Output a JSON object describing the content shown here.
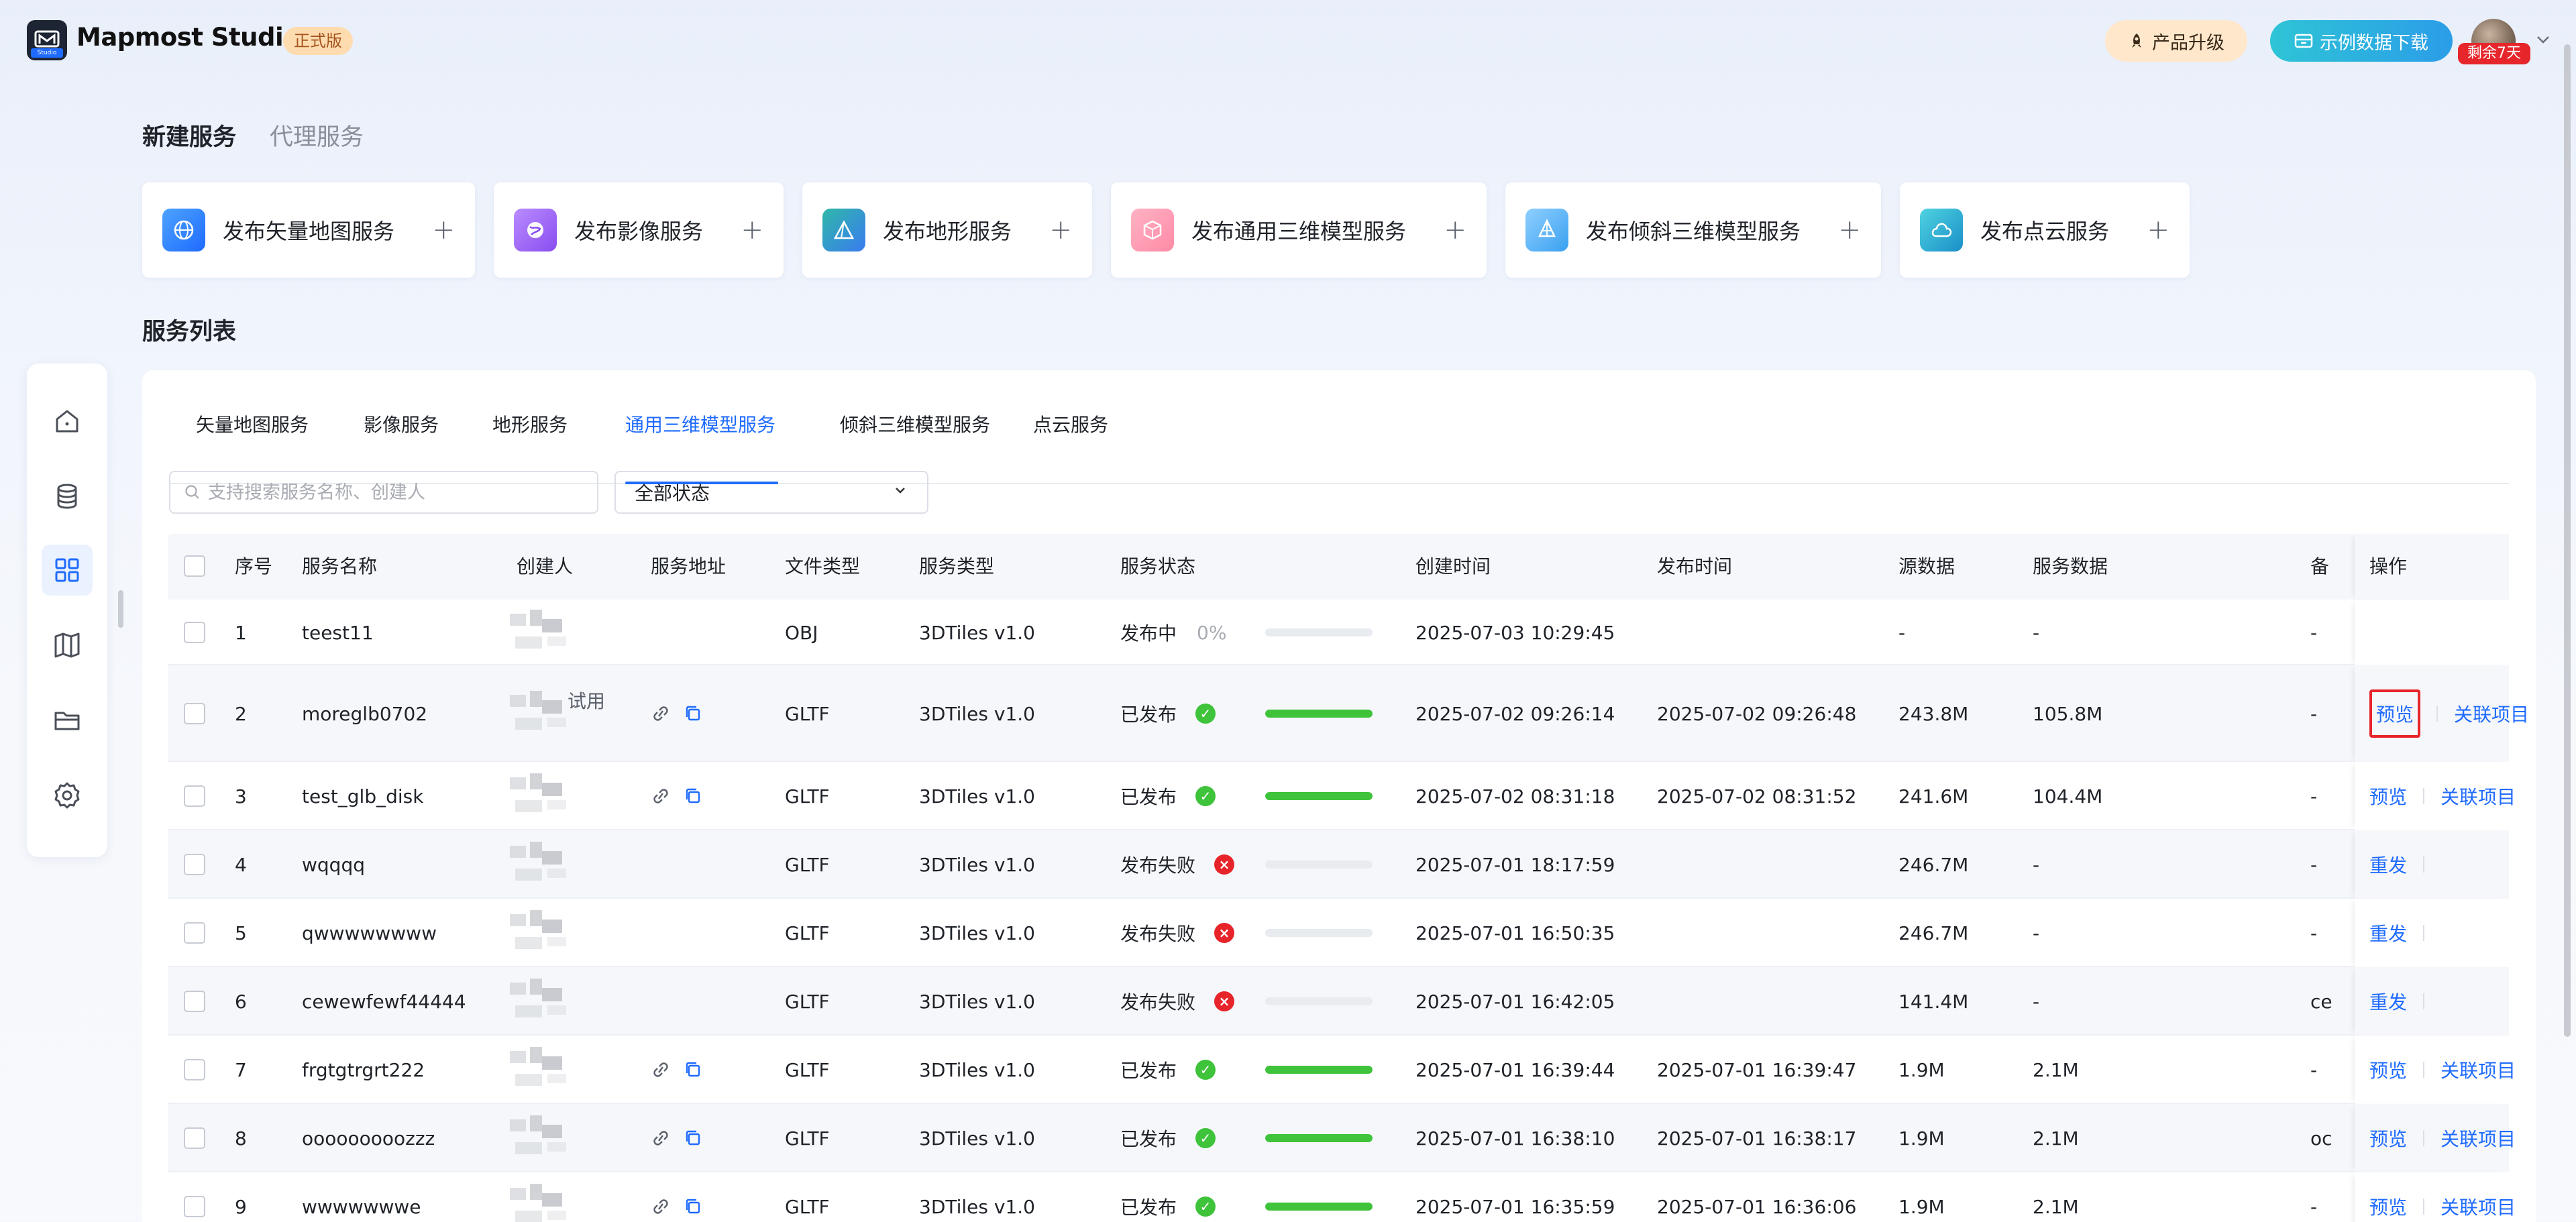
{
  "app": {
    "brand": "Mapmost Studio",
    "logo_sub": "Studio",
    "edition": "正式版",
    "upgrade_label": "产品升级",
    "download_label": "示例数据下载",
    "trial_badge": "剩余7天"
  },
  "top_tabs": [
    {
      "label": "新建服务",
      "active": true
    },
    {
      "label": "代理服务",
      "active": false
    }
  ],
  "publish_cards": [
    {
      "label": "发布矢量地图服务",
      "icon": "globe-icon",
      "color": "#2b8cf0"
    },
    {
      "label": "发布影像服务",
      "icon": "planet-icon",
      "color": "#9b5cf0"
    },
    {
      "label": "发布地形服务",
      "icon": "mountain-icon",
      "color": "#1fb58c"
    },
    {
      "label": "发布通用三维模型服务",
      "icon": "cube-icon",
      "color": "#f06a8a"
    },
    {
      "label": "发布倾斜三维模型服务",
      "icon": "tilted-model-icon",
      "color": "#34a6f0"
    },
    {
      "label": "发布点云服务",
      "icon": "cloud-icon",
      "color": "#1aa3c8"
    }
  ],
  "list_title": "服务列表",
  "sidebar": [
    {
      "icon": "home-icon",
      "active": false
    },
    {
      "icon": "database-icon",
      "active": false
    },
    {
      "icon": "grid-icon",
      "active": true
    },
    {
      "icon": "map-icon",
      "active": false
    },
    {
      "icon": "folder-icon",
      "active": false
    },
    {
      "icon": "settings-icon",
      "active": false
    }
  ],
  "service_tabs": [
    {
      "label": "矢量地图服务",
      "active": false
    },
    {
      "label": "影像服务",
      "active": false
    },
    {
      "label": "地形服务",
      "active": false
    },
    {
      "label": "通用三维模型服务",
      "active": true
    },
    {
      "label": "倾斜三维模型服务",
      "active": false
    },
    {
      "label": "点云服务",
      "active": false
    }
  ],
  "filters": {
    "search_placeholder": "支持搜索服务名称、创建人",
    "status_value": "全部状态"
  },
  "table": {
    "headers": {
      "index": "序号",
      "name": "服务名称",
      "creator": "创建人",
      "address": "服务地址",
      "file_type": "文件类型",
      "service_type": "服务类型",
      "status": "服务状态",
      "created": "创建时间",
      "published": "发布时间",
      "source": "源数据",
      "service_data": "服务数据",
      "remark": "备",
      "actions": "操作"
    },
    "rows": [
      {
        "index": "1",
        "name": "teest11",
        "creator_suffix": "",
        "has_address": false,
        "file_type": "OBJ",
        "service_type": "3DTiles v1.0",
        "status": "发布中",
        "state": "progress",
        "percent": "0%",
        "progress": 0,
        "created": "2025-07-03 10:29:45",
        "published": "",
        "source": "-",
        "service_data": "-",
        "remark": "-",
        "actions": []
      },
      {
        "index": "2",
        "name": "moreglb0702",
        "creator_suffix": "试用",
        "has_address": true,
        "file_type": "GLTF",
        "service_type": "3DTiles v1.0",
        "status": "已发布",
        "state": "ok",
        "percent": "",
        "progress": 1,
        "created": "2025-07-02 09:26:14",
        "published": "2025-07-02 09:26:48",
        "source": "243.8M",
        "service_data": "105.8M",
        "remark": "-",
        "actions": [
          "预览",
          "关联项目"
        ],
        "highlight_first": true
      },
      {
        "index": "3",
        "name": "test_glb_disk",
        "creator_suffix": "",
        "has_address": true,
        "file_type": "GLTF",
        "service_type": "3DTiles v1.0",
        "status": "已发布",
        "state": "ok",
        "percent": "",
        "progress": 1,
        "created": "2025-07-02 08:31:18",
        "published": "2025-07-02 08:31:52",
        "source": "241.6M",
        "service_data": "104.4M",
        "remark": "-",
        "actions": [
          "预览",
          "关联项目"
        ]
      },
      {
        "index": "4",
        "name": "wqqqq",
        "creator_suffix": "",
        "has_address": false,
        "file_type": "GLTF",
        "service_type": "3DTiles v1.0",
        "status": "发布失败",
        "state": "fail",
        "percent": "",
        "progress": 0,
        "created": "2025-07-01 18:17:59",
        "published": "",
        "source": "246.7M",
        "service_data": "-",
        "remark": "-",
        "actions": [
          "重发"
        ]
      },
      {
        "index": "5",
        "name": "qwwwwwwww",
        "creator_suffix": "",
        "has_address": false,
        "file_type": "GLTF",
        "service_type": "3DTiles v1.0",
        "status": "发布失败",
        "state": "fail",
        "percent": "",
        "progress": 0,
        "created": "2025-07-01 16:50:35",
        "published": "",
        "source": "246.7M",
        "service_data": "-",
        "remark": "-",
        "actions": [
          "重发"
        ]
      },
      {
        "index": "6",
        "name": "cewewfewf44444",
        "creator_suffix": "",
        "has_address": false,
        "file_type": "GLTF",
        "service_type": "3DTiles v1.0",
        "status": "发布失败",
        "state": "fail",
        "percent": "",
        "progress": 0,
        "created": "2025-07-01 16:42:05",
        "published": "",
        "source": "141.4M",
        "service_data": "-",
        "remark": "ce",
        "actions": [
          "重发"
        ]
      },
      {
        "index": "7",
        "name": "frgtgtrgrt222",
        "creator_suffix": "",
        "has_address": true,
        "file_type": "GLTF",
        "service_type": "3DTiles v1.0",
        "status": "已发布",
        "state": "ok",
        "percent": "",
        "progress": 1,
        "created": "2025-07-01 16:39:44",
        "published": "2025-07-01 16:39:47",
        "source": "1.9M",
        "service_data": "2.1M",
        "remark": "-",
        "actions": [
          "预览",
          "关联项目"
        ]
      },
      {
        "index": "8",
        "name": "ooooooooozzz",
        "creator_suffix": "",
        "has_address": true,
        "file_type": "GLTF",
        "service_type": "3DTiles v1.0",
        "status": "已发布",
        "state": "ok",
        "percent": "",
        "progress": 1,
        "created": "2025-07-01 16:38:10",
        "published": "2025-07-01 16:38:17",
        "source": "1.9M",
        "service_data": "2.1M",
        "remark": "oc",
        "actions": [
          "预览",
          "关联项目"
        ]
      },
      {
        "index": "9",
        "name": "wwwwwwwe",
        "creator_suffix": "",
        "has_address": true,
        "file_type": "GLTF",
        "service_type": "3DTiles v1.0",
        "status": "已发布",
        "state": "ok",
        "percent": "",
        "progress": 1,
        "created": "2025-07-01 16:35:59",
        "published": "2025-07-01 16:36:06",
        "source": "1.9M",
        "service_data": "2.1M",
        "remark": "-",
        "actions": [
          "预览",
          "关联项目"
        ]
      }
    ]
  }
}
